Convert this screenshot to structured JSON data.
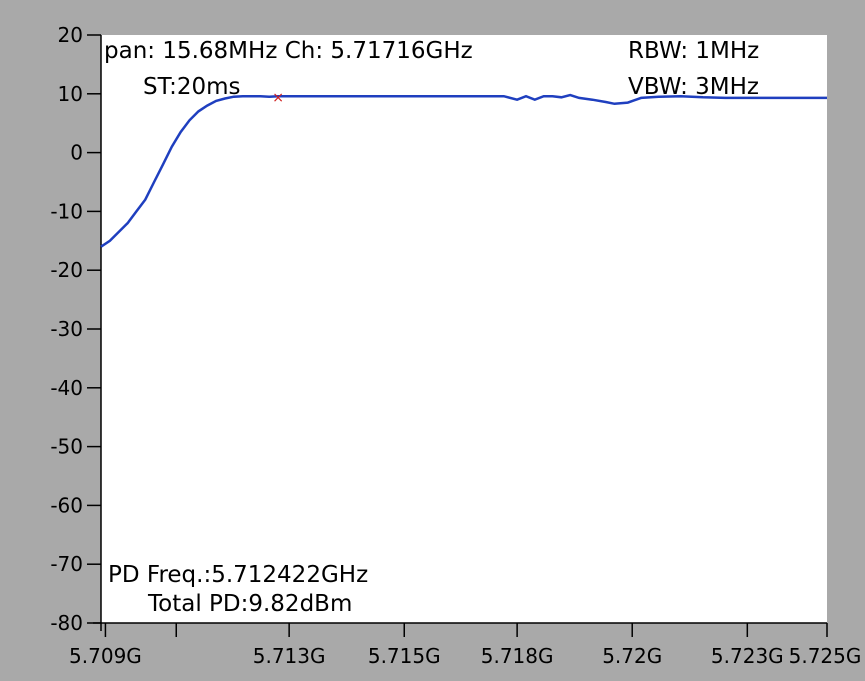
{
  "chart_data": {
    "type": "line",
    "title": "",
    "xlabel": "",
    "ylabel": "",
    "xlim": [
      5.7084,
      5.7248
    ],
    "ylim": [
      -80,
      20
    ],
    "y_ticks": [
      20,
      10,
      0,
      -10,
      -20,
      -30,
      -40,
      -50,
      -60,
      -70,
      -80
    ],
    "y_tick_labels": [
      "20",
      "10",
      "0",
      "-10",
      "-20",
      "-30",
      "-40",
      "-50",
      "-60",
      "-70",
      "-80"
    ],
    "x_ticks": [
      5.7085,
      5.7101,
      5.71265,
      5.71525,
      5.7178,
      5.7204,
      5.723,
      5.7255
    ],
    "x_tick_labels": [
      "5.709G",
      "",
      "5.713G",
      "5.715G",
      "5.718G",
      "5.72G",
      "5.723G",
      "5.725G"
    ],
    "grid": false,
    "series": [
      {
        "color": "#1f3fbf",
        "x": [
          5.7084,
          5.7086,
          5.7088,
          5.709,
          5.7092,
          5.7094,
          5.7096,
          5.7098,
          5.71,
          5.7102,
          5.7104,
          5.7106,
          5.7108,
          5.711,
          5.7112,
          5.7114,
          5.7116,
          5.7118,
          5.712,
          5.7122,
          5.7124,
          5.713,
          5.7135,
          5.714,
          5.7145,
          5.715,
          5.7155,
          5.716,
          5.7165,
          5.717,
          5.7175,
          5.7178,
          5.718,
          5.7182,
          5.7184,
          5.7186,
          5.7188,
          5.719,
          5.7192,
          5.7195,
          5.7198,
          5.72,
          5.7203,
          5.7206,
          5.721,
          5.7215,
          5.722,
          5.7225,
          5.723,
          5.7235,
          5.724,
          5.7245,
          5.7248
        ],
        "y": [
          -16,
          -15,
          -13.5,
          -12,
          -10,
          -8,
          -5,
          -2,
          1,
          3.5,
          5.5,
          7,
          8,
          8.8,
          9.2,
          9.5,
          9.6,
          9.6,
          9.6,
          9.5,
          9.6,
          9.6,
          9.6,
          9.6,
          9.6,
          9.6,
          9.6,
          9.6,
          9.6,
          9.6,
          9.6,
          9.0,
          9.6,
          9.0,
          9.6,
          9.6,
          9.4,
          9.8,
          9.3,
          9.0,
          8.6,
          8.3,
          8.5,
          9.3,
          9.5,
          9.6,
          9.4,
          9.3,
          9.3,
          9.3,
          9.3,
          9.3,
          9.3
        ]
      }
    ],
    "marker": {
      "x": 5.7124,
      "y": 9.6,
      "color": "#d02020"
    },
    "annotations": {
      "span": "pan: 15.68MHz Ch: 5.71716GHz",
      "sweep_time": "ST:20ms",
      "rbw": "RBW: 1MHz",
      "vbw": "VBW: 3MHz",
      "pd_freq": "PD Freq.:5.712422GHz",
      "total_pd": "Total PD:9.82dBm"
    },
    "colors": {
      "outer_bg": "#a9a9a9",
      "plot_bg": "#ffffff",
      "trace": "#1f3fbf",
      "marker": "#d02020"
    }
  }
}
